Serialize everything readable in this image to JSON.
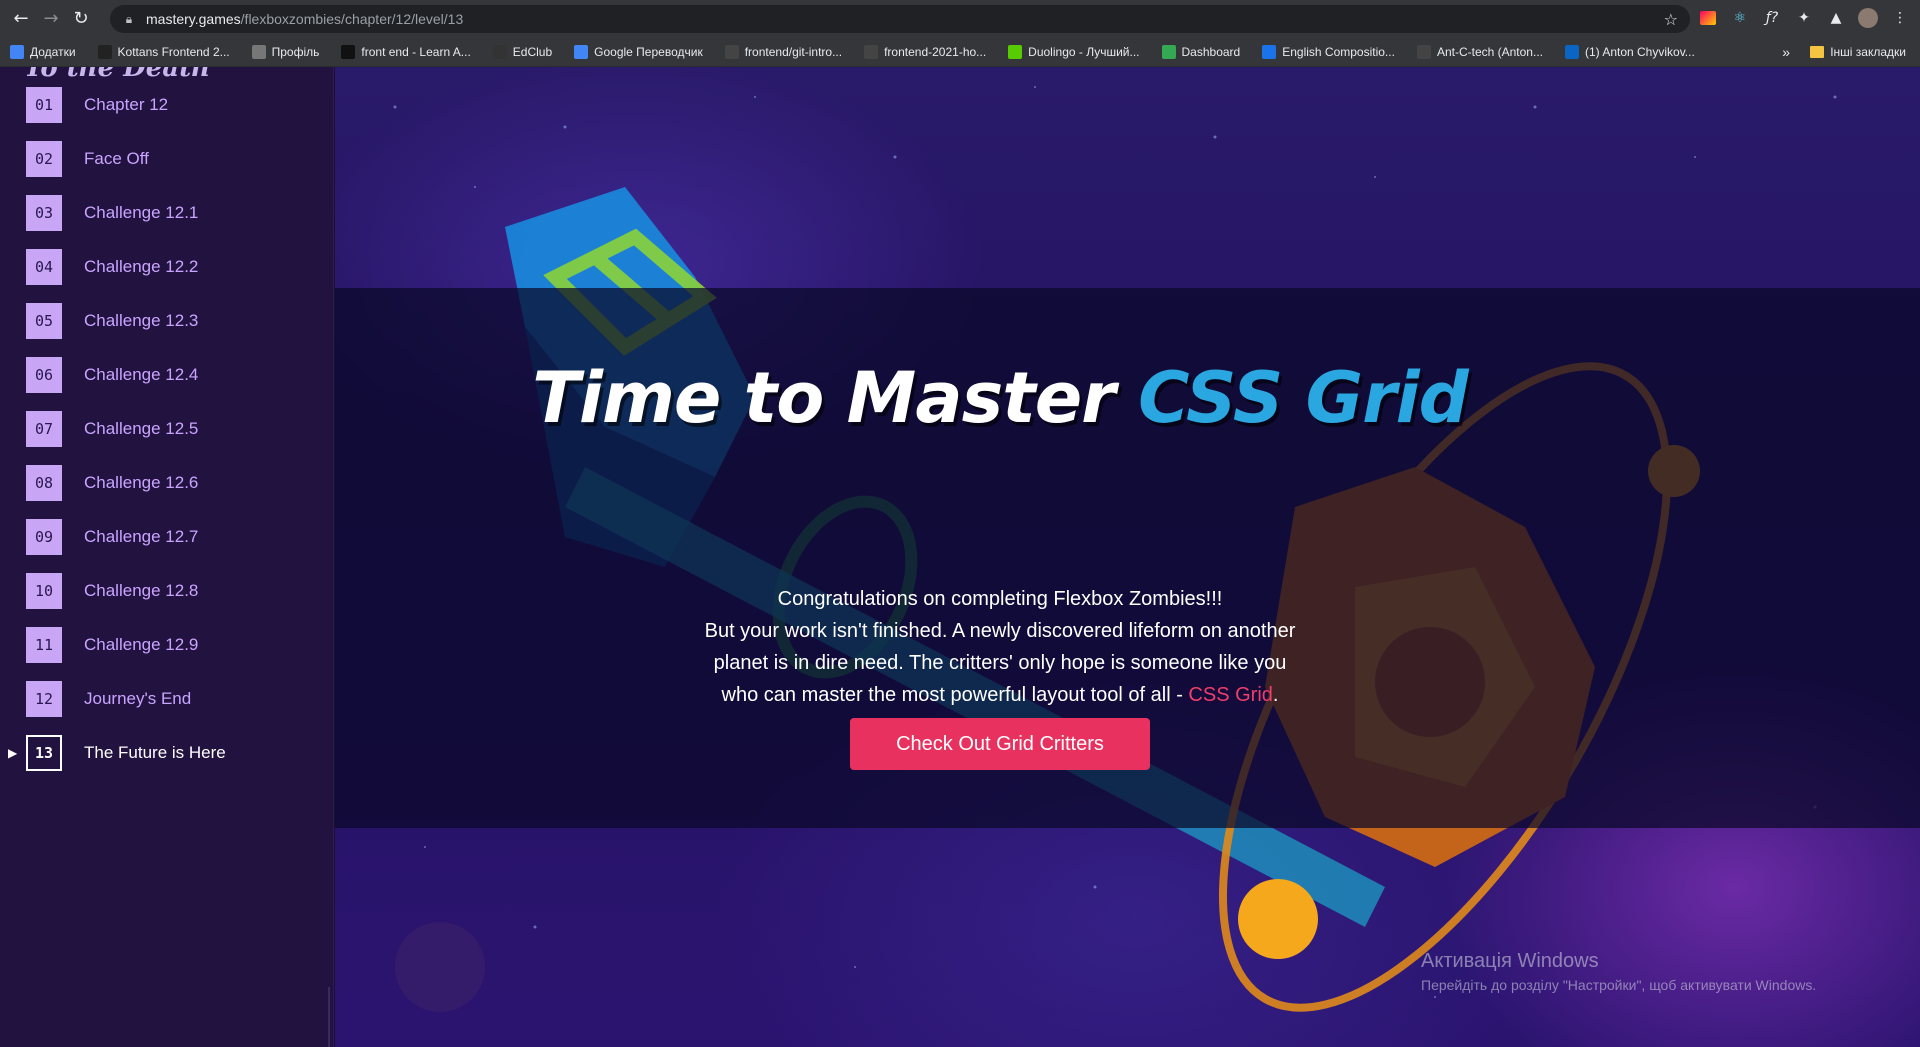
{
  "browser": {
    "url_host": "mastery.games",
    "url_path": "/flexboxzombies/chapter/12/level/13",
    "bookmarks": [
      {
        "label": "Додатки",
        "icon": "apps-grid-icon",
        "color": "#4285f4"
      },
      {
        "label": "Kottans Frontend 2...",
        "icon": "kottans-icon",
        "color": "#222222"
      },
      {
        "label": "Профіль",
        "icon": "profile-icon",
        "color": "#777777"
      },
      {
        "label": "front end - Learn A...",
        "icon": "bookmark-icon",
        "color": "#111111"
      },
      {
        "label": "EdClub",
        "icon": "edclub-icon",
        "color": "#333333"
      },
      {
        "label": "Google Переводчик",
        "icon": "google-translate-icon",
        "color": "#4285f4"
      },
      {
        "label": "frontend/git-intro...",
        "icon": "github-icon",
        "color": "#444444"
      },
      {
        "label": "frontend-2021-ho...",
        "icon": "github-icon",
        "color": "#444444"
      },
      {
        "label": "Duolingo - Лучший...",
        "icon": "duolingo-icon",
        "color": "#58cc02"
      },
      {
        "label": "Dashboard",
        "icon": "dashboard-icon",
        "color": "#34a853"
      },
      {
        "label": "English Compositio...",
        "icon": "coursera-icon",
        "color": "#1a73e8"
      },
      {
        "label": "Ant-C-tech (Anton...",
        "icon": "github-icon",
        "color": "#444444"
      },
      {
        "label": "(1) Anton Chyvikov...",
        "icon": "linkedin-icon",
        "color": "#0a66c2"
      }
    ],
    "more_label": "»",
    "other_bookmarks": "Інші закладки"
  },
  "sidebar": {
    "heading": "To the Death",
    "levels": [
      {
        "num": "01",
        "label": "Chapter 12"
      },
      {
        "num": "02",
        "label": "Face Off"
      },
      {
        "num": "03",
        "label": "Challenge 12.1"
      },
      {
        "num": "04",
        "label": "Challenge 12.2"
      },
      {
        "num": "05",
        "label": "Challenge 12.3"
      },
      {
        "num": "06",
        "label": "Challenge 12.4"
      },
      {
        "num": "07",
        "label": "Challenge 12.5"
      },
      {
        "num": "08",
        "label": "Challenge 12.6"
      },
      {
        "num": "09",
        "label": "Challenge 12.7"
      },
      {
        "num": "10",
        "label": "Challenge 12.8"
      },
      {
        "num": "11",
        "label": "Challenge 12.9"
      },
      {
        "num": "12",
        "label": "Journey's End"
      },
      {
        "num": "13",
        "label": "The Future is Here",
        "active": true
      }
    ]
  },
  "hero": {
    "title_main": "Time to Master ",
    "title_accent": "CSS Grid",
    "line1": "Congratulations on completing Flexbox Zombies!!!",
    "line2": "But your work isn't finished. A newly discovered lifeform on another",
    "line3": "planet is in dire need. The critters' only hope is someone like you",
    "line4_prefix": "who can master the most powerful layout tool of all - ",
    "line4_link": "CSS Grid",
    "line4_suffix": ".",
    "cta_label": "Check Out Grid Critters"
  },
  "watermark": {
    "line1": "Активація Windows",
    "line2": "Перейдіть до розділу \"Настройки\", щоб активувати Windows."
  },
  "colors": {
    "accent_blue": "#2aa7e0",
    "cta_red": "#e8315f",
    "link_red": "#ef3e6a",
    "sidebar_bg": "#22123f",
    "level_badge": "#c8a6f5"
  }
}
